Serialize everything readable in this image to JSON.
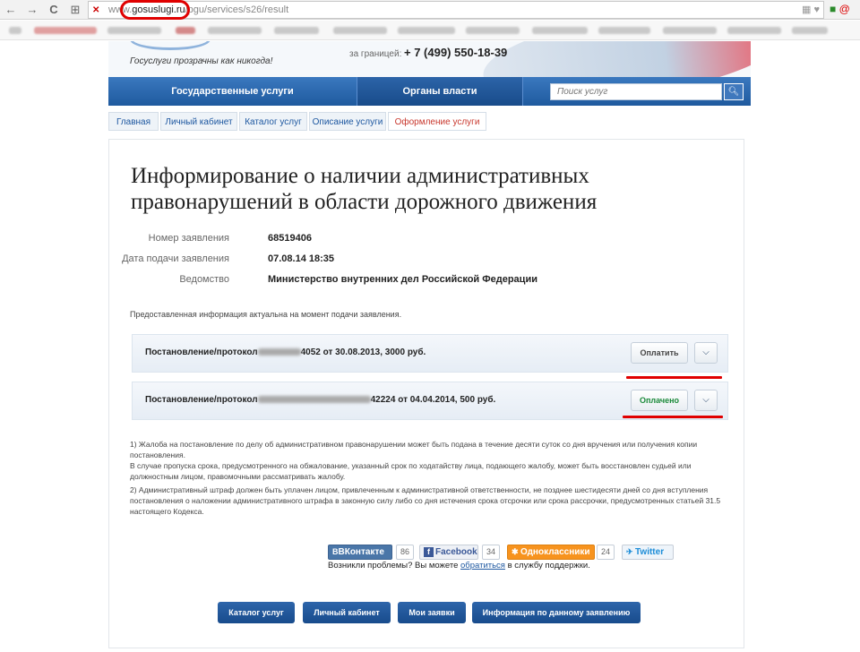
{
  "browser": {
    "url_prefix": "www.",
    "url_domain": "gosuslugi.ru",
    "url_path": "/pgu/services/s26/result",
    "back_glyph": "←",
    "forward_glyph": "→",
    "reload_glyph": "C",
    "apps_glyph": "⊞",
    "more_glyph": "»"
  },
  "header": {
    "slogan": "Госуслуги прозрачны как никогда!",
    "phone_label": "за границей:",
    "phone": "+ 7 (499) 550-18-39"
  },
  "mainnav": {
    "tab1": "Государственные услуги",
    "tab2": "Органы власти",
    "search_placeholder": "Поиск услуг",
    "search_icon": "magnifier-icon"
  },
  "breadcrumbs": [
    "Главная",
    "Личный кабинет",
    "Каталог услуг",
    "Описание услуги",
    "Оформление услуги"
  ],
  "page": {
    "title": "Информирование о наличии административных правонарушений в области дорожного движения",
    "fields": [
      {
        "label": "Номер заявления",
        "value": "68519406"
      },
      {
        "label": "Дата подачи заявления",
        "value": "07.08.14 18:35"
      },
      {
        "label": "Ведомство",
        "value": "Министерство внутренних дел Российской Федерации"
      }
    ],
    "note": "Предоставленная информация актуальна на момент подачи заявления.",
    "protocols": [
      {
        "prefix": "Постановление/протокол",
        "suffix": "4052 от 30.08.2013, 3000 руб.",
        "button": "Оплатить",
        "status": "unpaid"
      },
      {
        "prefix": "Постановление/протокол",
        "suffix": "42224 от 04.04.2014, 500 руб.",
        "button": "Оплачено",
        "status": "paid"
      }
    ],
    "footnotes": [
      "1) Жалоба на постановление по делу об административном правонарушении может быть подана в течение десяти суток со дня вручения или получения копии постановления.",
      "В случае пропуска срока, предусмотренного на обжалование, указанный срок по ходатайству лица, подающего жалобу, может быть восстановлен судьей или должностным лицом, правомочными рассматривать жалобу.",
      "2) Административный штраф должен быть уплачен лицом, привлеченным к административной ответственности, не позднее шестидесяти дней со дня вступления постановления о наложении административного штрафа в законную силу либо со дня истечения срока отсрочки или срока рассрочки, предусмотренных статьей 31.5 настоящего Кодекса."
    ]
  },
  "social": [
    {
      "name": "ВКонтакте",
      "count": "86",
      "icon": "vk-icon",
      "color": "#4a76a8"
    },
    {
      "name": "Facebook",
      "count": "34",
      "icon": "facebook-icon",
      "color": "#3b5998"
    },
    {
      "name": "Одноклассники",
      "count": "24",
      "icon": "odnoklassniki-icon",
      "color": "#f7931e"
    },
    {
      "name": "Twitter",
      "count": "",
      "icon": "twitter-icon",
      "color": "#1d8dd8"
    }
  ],
  "support": {
    "before": "Возникли проблемы? Вы можете ",
    "link": "обратиться",
    "after": " в службу поддержки."
  },
  "bottom_buttons": [
    "Каталог услуг",
    "Личный кабинет",
    "Мои заявки",
    "Информация по данному заявлению"
  ],
  "colors": {
    "accent": "#1f5a9e",
    "link": "#1d57a0",
    "paid": "#1b8a3a",
    "highlight": "#e00000"
  }
}
